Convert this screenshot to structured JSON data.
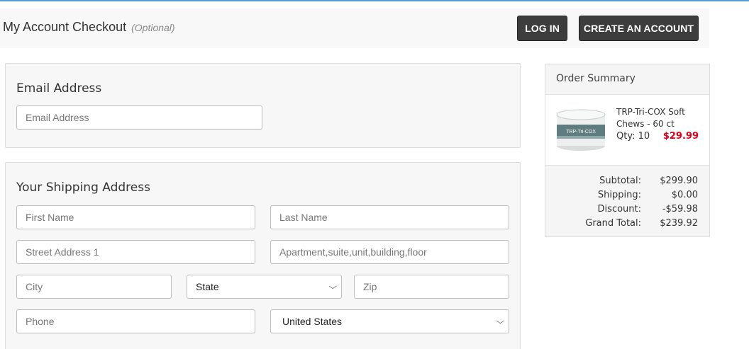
{
  "header": {
    "title": "My Account Checkout",
    "optional": "(Optional)",
    "login_label": "LOG IN",
    "create_account_label": "CREATE AN ACCOUNT"
  },
  "email_section": {
    "title": "Email Address",
    "email_placeholder": "Email Address"
  },
  "shipping_section": {
    "title": "Your Shipping Address",
    "first_name_placeholder": "First Name",
    "last_name_placeholder": "Last Name",
    "street_placeholder": "Street Address 1",
    "apt_placeholder": "Apartment,suite,unit,building,floor",
    "city_placeholder": "City",
    "state_selected": "State",
    "zip_placeholder": "Zip",
    "phone_placeholder": "Phone",
    "country_selected": "United States"
  },
  "order_summary": {
    "title": "Order Summary",
    "item": {
      "name": "TRP-Tri-COX Soft Chews - 60 ct",
      "qty": "Qty: 10",
      "price": "$29.99",
      "image_label": "TRP-Tri-COX"
    },
    "totals": [
      {
        "label": "Subtotal:",
        "value": "$299.90"
      },
      {
        "label": "Shipping:",
        "value": "$0.00"
      },
      {
        "label": "Discount:",
        "value": "-$59.98"
      },
      {
        "label": "Grand Total:",
        "value": "$239.92"
      }
    ]
  },
  "colors": {
    "accent_line": "#5b9bd5",
    "dark_button": "#3d3d3d",
    "price_red": "#e0001b"
  }
}
